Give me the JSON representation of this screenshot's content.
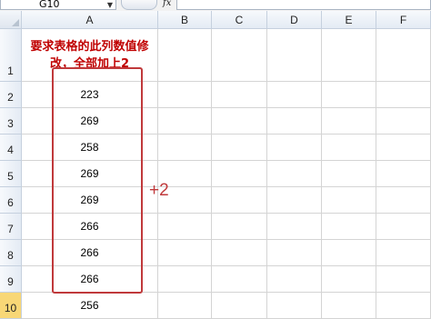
{
  "formula_bar": {
    "name_box": "G10",
    "fx_label": "fx",
    "formula": ""
  },
  "columns": [
    "A",
    "B",
    "C",
    "D",
    "E",
    "F"
  ],
  "rows": [
    "1",
    "2",
    "3",
    "4",
    "5",
    "6",
    "7",
    "8",
    "9",
    "10"
  ],
  "cells": {
    "A1": "要求表格的此列数值修改，全部加上2",
    "A2": "223",
    "A3": "269",
    "A4": "258",
    "A5": "269",
    "A6": "269",
    "A7": "266",
    "A8": "266",
    "A9": "266",
    "A10": "256"
  },
  "annotation": {
    "text": "+2",
    "color": "#c0393b"
  },
  "colors": {
    "note_text": "#c00000",
    "active_row_header": "#f8d776"
  },
  "active_cell": "G10"
}
